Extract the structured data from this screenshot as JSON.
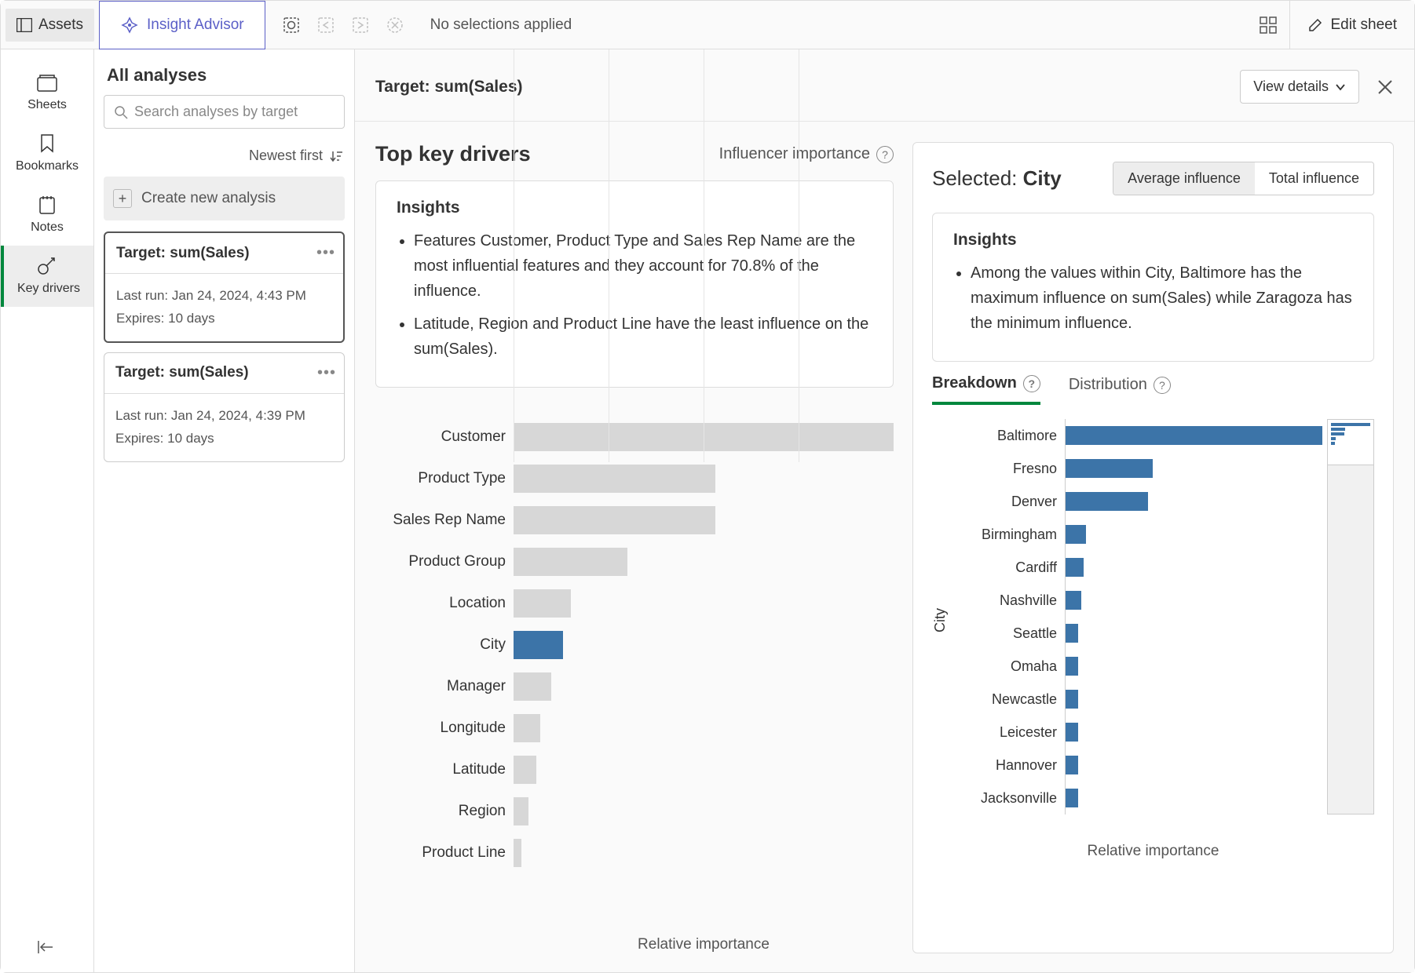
{
  "toolbar": {
    "assets_label": "Assets",
    "insight_label": "Insight Advisor",
    "no_selections": "No selections applied",
    "edit_sheet": "Edit sheet"
  },
  "rail": {
    "sheets": "Sheets",
    "bookmarks": "Bookmarks",
    "notes": "Notes",
    "key_drivers": "Key drivers"
  },
  "analyses": {
    "title": "All analyses",
    "search_placeholder": "Search analyses by target",
    "sort_label": "Newest first",
    "create_label": "Create new analysis",
    "cards": [
      {
        "title": "Target: sum(Sales)",
        "last_run": "Last run: Jan 24, 2024, 4:43 PM",
        "expires": "Expires: 10 days",
        "selected": true
      },
      {
        "title": "Target: sum(Sales)",
        "last_run": "Last run: Jan 24, 2024, 4:39 PM",
        "expires": "Expires: 10 days",
        "selected": false
      }
    ]
  },
  "main": {
    "target_title": "Target: sum(Sales)",
    "view_details": "View details",
    "drivers_title": "Top key drivers",
    "influencer_label": "Influencer importance",
    "insights_heading": "Insights",
    "insights": [
      "Features Customer, Product Type and Sales Rep Name are the most influential features and they account for 70.8% of the influence.",
      "Latitude, Region and Product Line have the least influence on the sum(Sales)."
    ],
    "x_axis_label": "Relative importance",
    "selected_prefix": "Selected: ",
    "selected_dim": "City",
    "avg_influence": "Average influence",
    "total_influence": "Total influence",
    "city_insights_heading": "Insights",
    "city_insight": "Among the values within City, Baltimore has the maximum influence on sum(Sales) while Zaragoza has the minimum influence.",
    "breakdown_tab": "Breakdown",
    "distribution_tab": "Distribution",
    "city_axis": "City",
    "mini_x_axis": "Relative importance"
  },
  "chart_data": [
    {
      "type": "bar",
      "orientation": "horizontal",
      "title": "Top key drivers",
      "xlabel": "Relative importance",
      "highlight": "City",
      "categories": [
        "Customer",
        "Product Type",
        "Sales Rep Name",
        "Product Group",
        "Location",
        "City",
        "Manager",
        "Longitude",
        "Latitude",
        "Region",
        "Product Line"
      ],
      "values": [
        100,
        53,
        53,
        30,
        15,
        13,
        10,
        7,
        6,
        4,
        2
      ]
    },
    {
      "type": "bar",
      "orientation": "horizontal",
      "title": "Selected: City — Breakdown",
      "xlabel": "Relative importance",
      "ylabel": "City",
      "categories": [
        "Baltimore",
        "Fresno",
        "Denver",
        "Birmingham",
        "Cardiff",
        "Nashville",
        "Seattle",
        "Omaha",
        "Newcastle",
        "Leicester",
        "Hannover",
        "Jacksonville"
      ],
      "values": [
        100,
        34,
        32,
        8,
        7,
        6,
        5,
        5,
        5,
        5,
        5,
        5
      ]
    }
  ]
}
